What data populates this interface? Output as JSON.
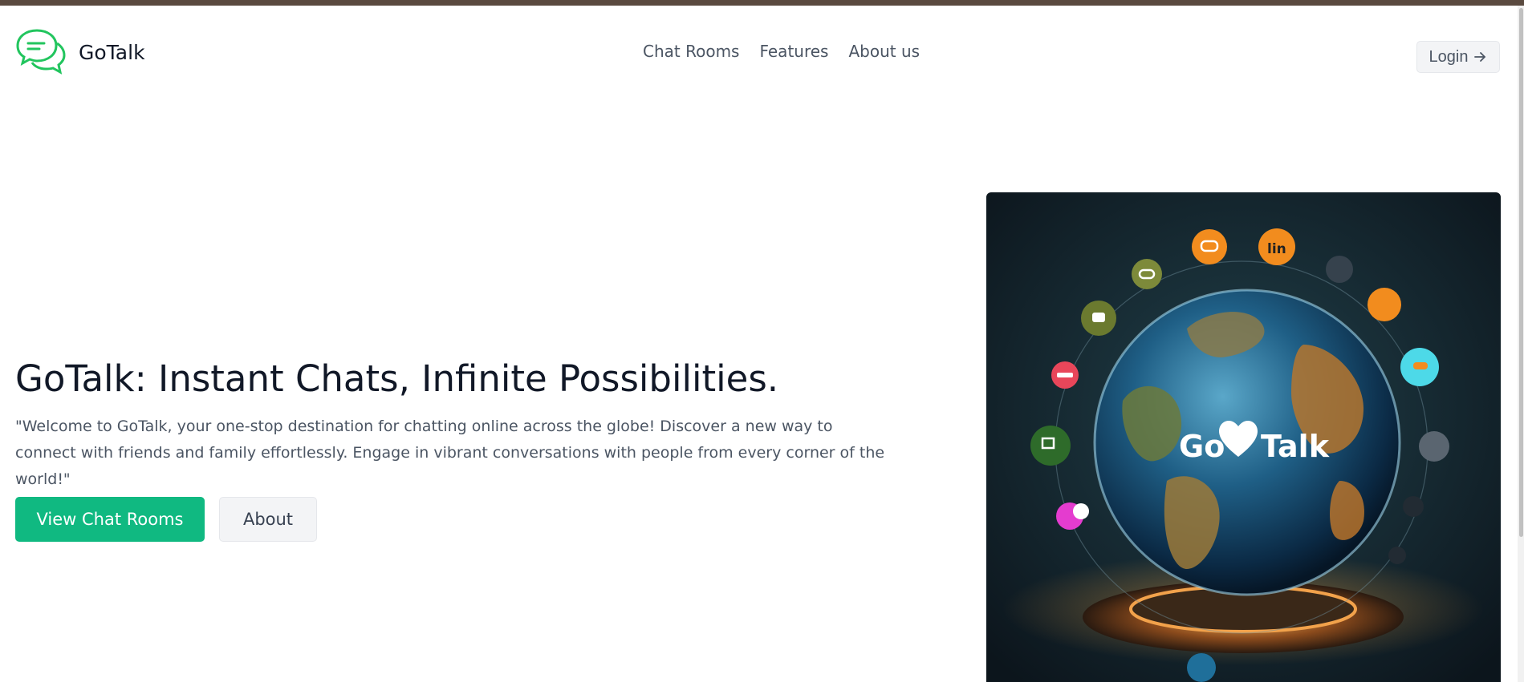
{
  "brand": {
    "name": "GoTalk",
    "logo_icon": "chat-bubbles-icon",
    "accent_color": "#22c55e"
  },
  "nav": {
    "items": [
      {
        "label": "Chat Rooms"
      },
      {
        "label": "Features"
      },
      {
        "label": "About us"
      }
    ],
    "login_label": "Login",
    "login_icon": "arrow-right-icon"
  },
  "hero": {
    "title": "GoTalk: Instant Chats, Infinite Possibilities.",
    "description": "\"Welcome to GoTalk, your one-stop destination for chatting online across the globe! Discover a new way to connect with friends and family effortlessly. Engage in vibrant conversations with people from every corner of the world!\"",
    "primary_button": "View Chat Rooms",
    "primary_color": "#10b981",
    "secondary_button": "About",
    "image": {
      "description": "globe-with-chat-bubbles-illustration",
      "overlay_text_left": "Go",
      "overlay_text_right": "Talk",
      "heart_icon": "heart-icon"
    }
  }
}
